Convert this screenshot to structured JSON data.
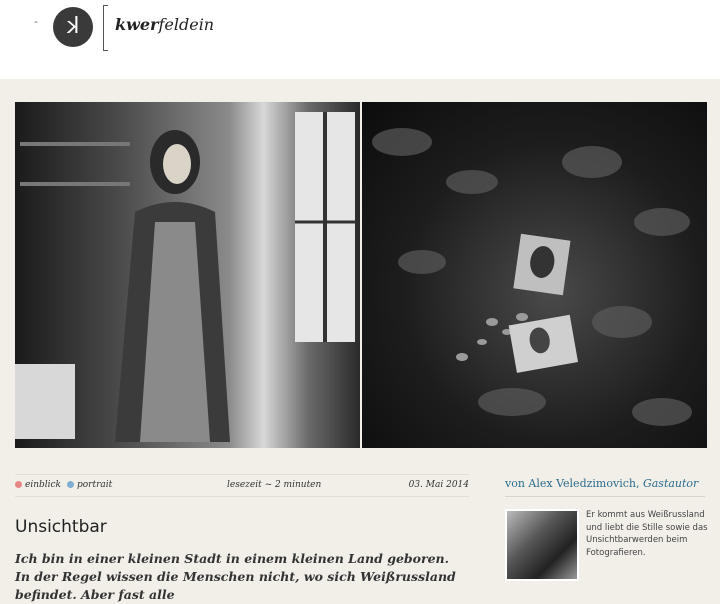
{
  "header": {
    "logo_letter": "k",
    "brand_bold": "kwer",
    "brand_rest": "feldein",
    "dash_left": "-",
    "dash_right": "-"
  },
  "hero": {
    "left_photo": "portrait-photo",
    "right_photo": "forest-photo"
  },
  "meta": {
    "categories": [
      {
        "label": "einblick",
        "color": "#e88585"
      },
      {
        "label": "portrait",
        "color": "#7fb0d3"
      }
    ],
    "reading_time": "lesezeit ~ 2 minuten",
    "date": "03. Mai 2014"
  },
  "article": {
    "title": "Unsichtbar",
    "lead": "Ich bin in einer kleinen Stadt in einem kleinen Land geboren. In der Regel wissen die Menschen nicht, wo sich Weißrussland befindet. Aber fast alle"
  },
  "author": {
    "prefix": "von",
    "name": "Alex Veledzimovich,",
    "role": "Gastautor",
    "bio": "Er kommt aus Weißrussland und liebt die Stille sowie das Unsichtbarwerden beim Fotografieren."
  },
  "colors": {
    "background": "#f1efe8",
    "link": "#2a6b8e"
  }
}
